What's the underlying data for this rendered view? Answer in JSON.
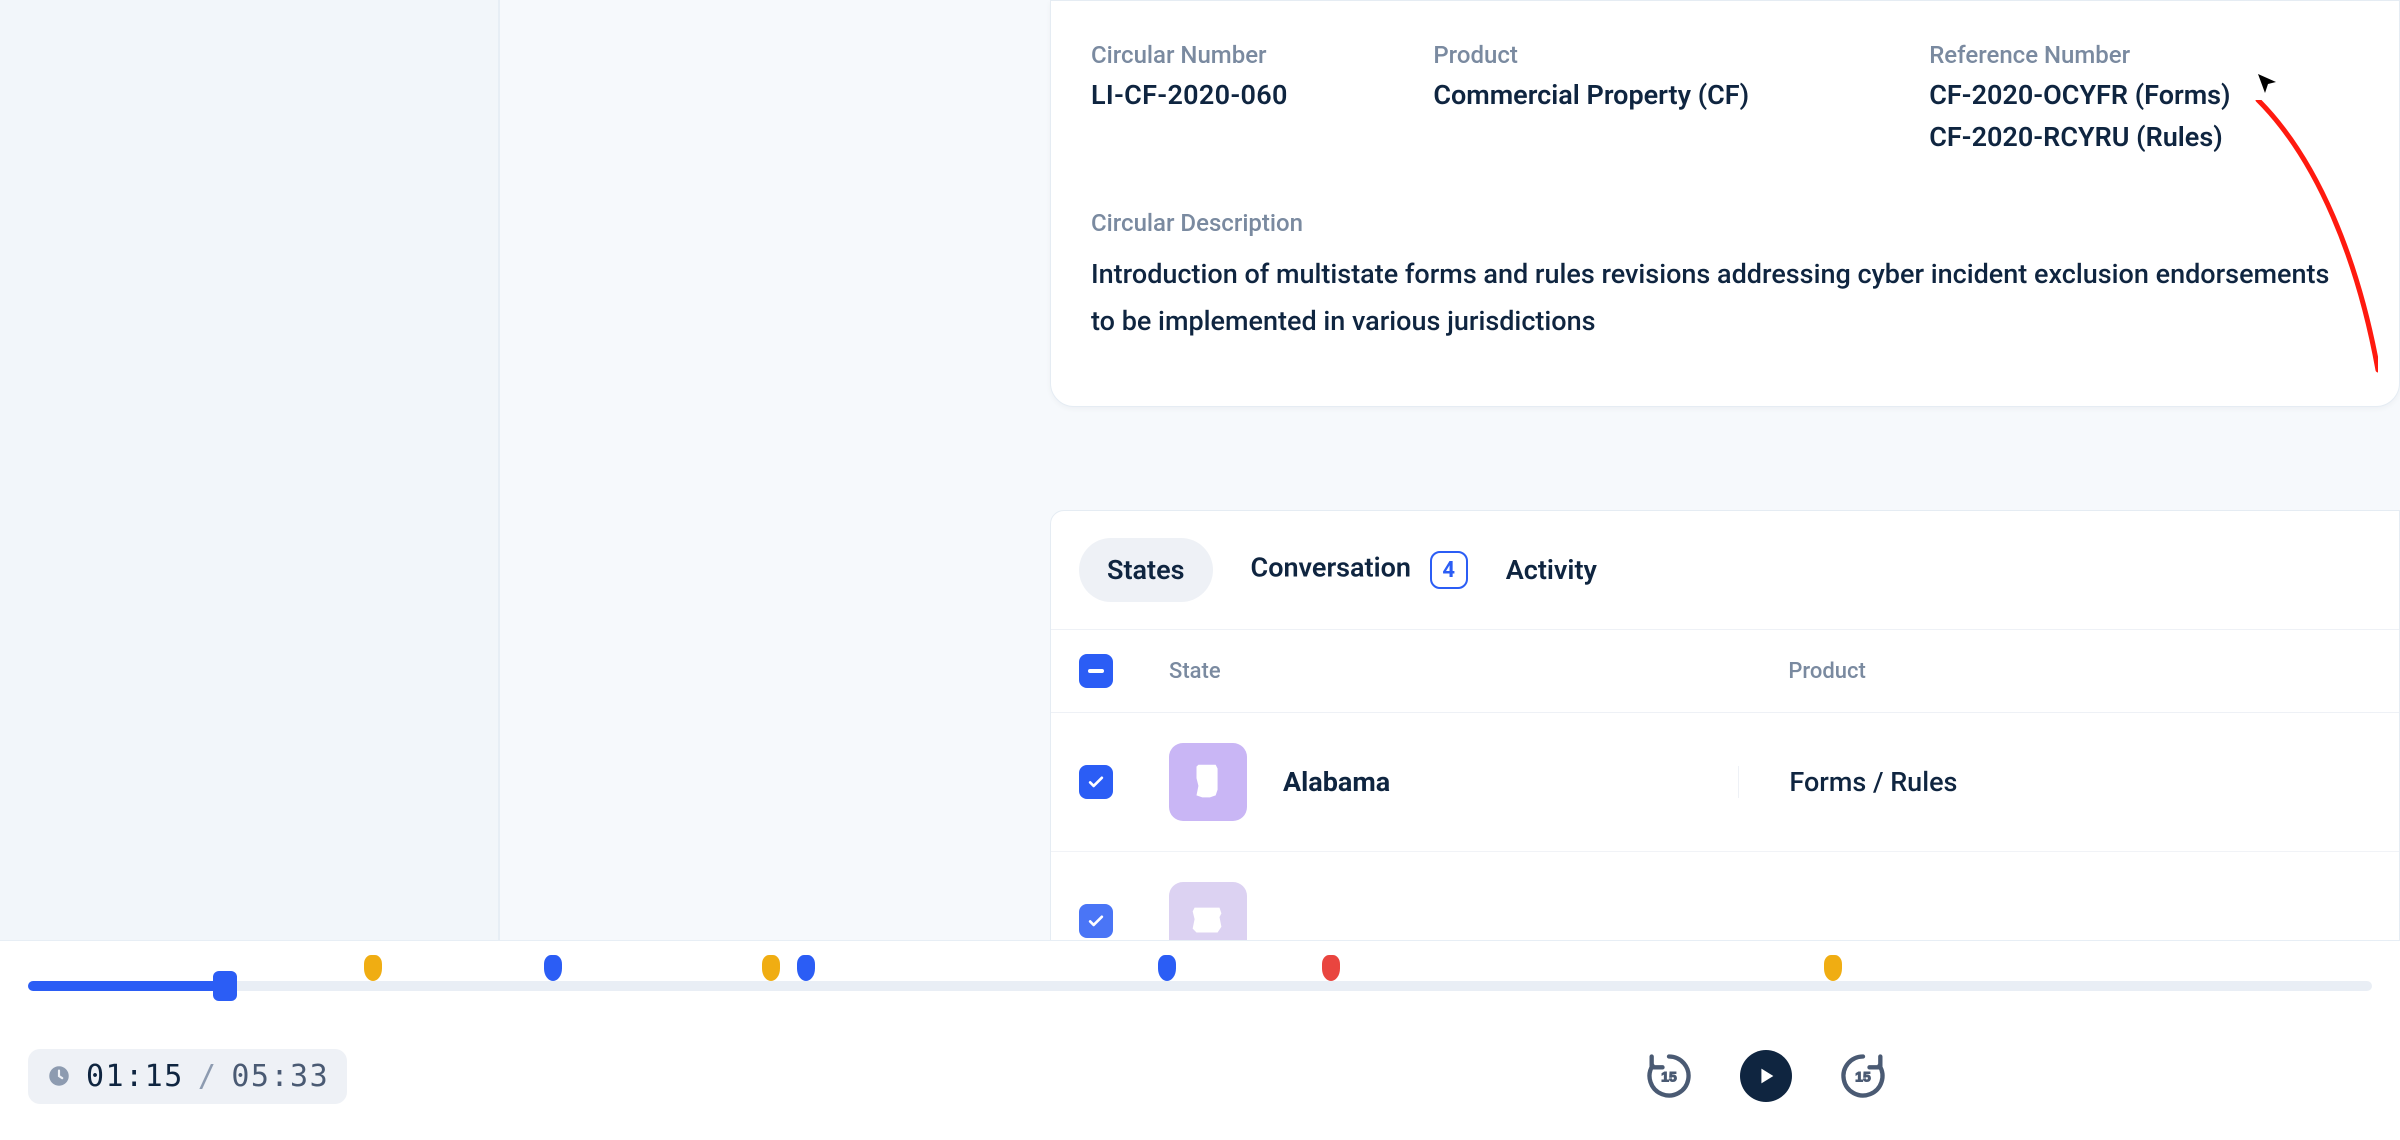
{
  "colors": {
    "accent": "#2b5df5",
    "textPrimary": "#0f2540",
    "textMuted": "#7a8aa0",
    "surface": "#ffffff",
    "app": "#f6f9fc",
    "tickOrange": "#f0ad12",
    "tickBlue": "#2b5df5",
    "tickRed": "#e9453f",
    "stateIconBg": "#c9b6f5"
  },
  "circular": {
    "numberLabel": "Circular Number",
    "numberValue": "LI-CF-2020-060",
    "productLabel": "Product",
    "productValue": "Commercial Property (CF)",
    "refLabel": "Reference Number",
    "refValues": {
      "r0": "CF-2020-OCYFR (Forms)",
      "r1": "CF-2020-RCYRU (Rules)"
    },
    "descLabel": "Circular Description",
    "descValue": "Introduction of multistate forms and rules revisions addressing cyber incident exclusion endorsements to be implemented in various jurisdictions"
  },
  "tabs": {
    "states": "States",
    "conversation": "Conversation",
    "conversationCount": "4",
    "activity": "Activity"
  },
  "table": {
    "header": {
      "state": "State",
      "product": "Product"
    },
    "rows": {
      "r0": {
        "state": "Alabama",
        "product": "Forms / Rules",
        "checked": true
      }
    }
  },
  "player": {
    "currentTime": "01:15",
    "separator": "/",
    "totalTime": "05:33",
    "progressPercent": 8.4,
    "jumpSeconds": "15",
    "ticks": [
      {
        "pos": 14.7,
        "color": "orange"
      },
      {
        "pos": 22.4,
        "color": "blue"
      },
      {
        "pos": 31.7,
        "color": "orange"
      },
      {
        "pos": 33.2,
        "color": "blue"
      },
      {
        "pos": 48.6,
        "color": "blue"
      },
      {
        "pos": 55.6,
        "color": "red"
      },
      {
        "pos": 77.0,
        "color": "orange"
      }
    ]
  }
}
